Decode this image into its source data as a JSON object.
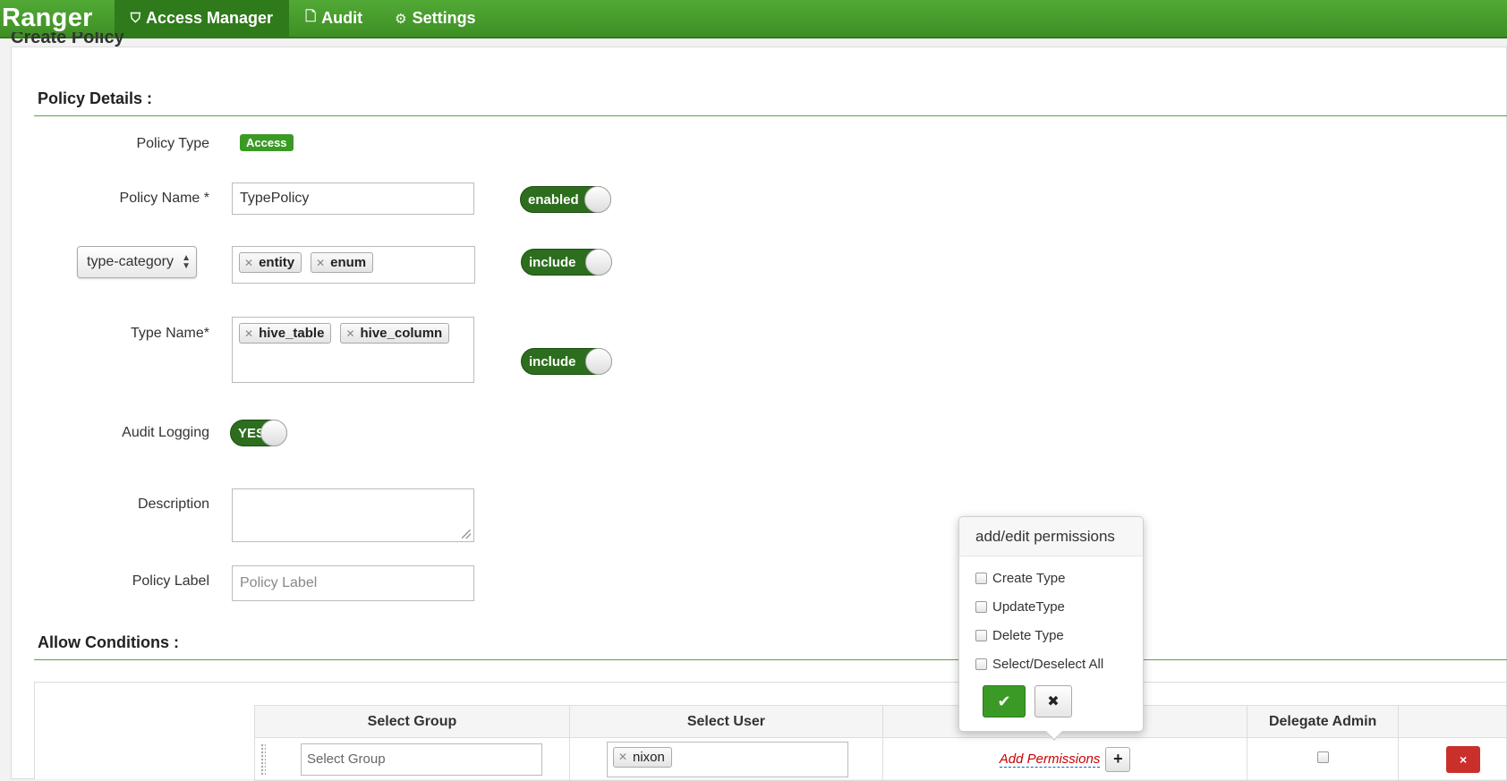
{
  "nav": {
    "brand": "Ranger",
    "items": [
      {
        "label": "Access Manager",
        "icon": "shield-icon",
        "glyph": "⛉"
      },
      {
        "label": "Audit",
        "icon": "file-icon",
        "glyph": "🗋"
      },
      {
        "label": "Settings",
        "icon": "gear-icon",
        "glyph": "⚙"
      }
    ]
  },
  "page": {
    "title": "Create Policy"
  },
  "details": {
    "section_title": "Policy Details :",
    "policy_type_label": "Policy Type",
    "policy_type_badge": "Access",
    "policy_name_label": "Policy Name *",
    "policy_name_value": "TypePolicy",
    "enabled_toggle": "enabled",
    "resource_select": "type-category",
    "resource_tags": [
      "entity",
      "enum"
    ],
    "resource_toggle": "include",
    "type_name_label": "Type Name*",
    "type_name_tags": [
      "hive_table",
      "hive_column"
    ],
    "type_name_toggle": "include",
    "audit_label": "Audit Logging",
    "audit_toggle": "YES",
    "description_label": "Description",
    "policy_label_label": "Policy Label",
    "policy_label_placeholder": "Policy Label"
  },
  "conditions": {
    "section_title": "Allow Conditions :",
    "columns": [
      "Select Group",
      "Select User",
      "",
      "Delegate Admin",
      ""
    ],
    "row": {
      "group_placeholder": "Select Group",
      "user_tags": [
        "nixon"
      ],
      "add_permissions": "Add Permissions",
      "plus": "+",
      "delete": "×"
    }
  },
  "popover": {
    "title": "add/edit permissions",
    "options": [
      "Create Type",
      "UpdateType",
      "Delete Type",
      "Select/Deselect All"
    ],
    "ok": "✔",
    "cancel": "✖"
  }
}
